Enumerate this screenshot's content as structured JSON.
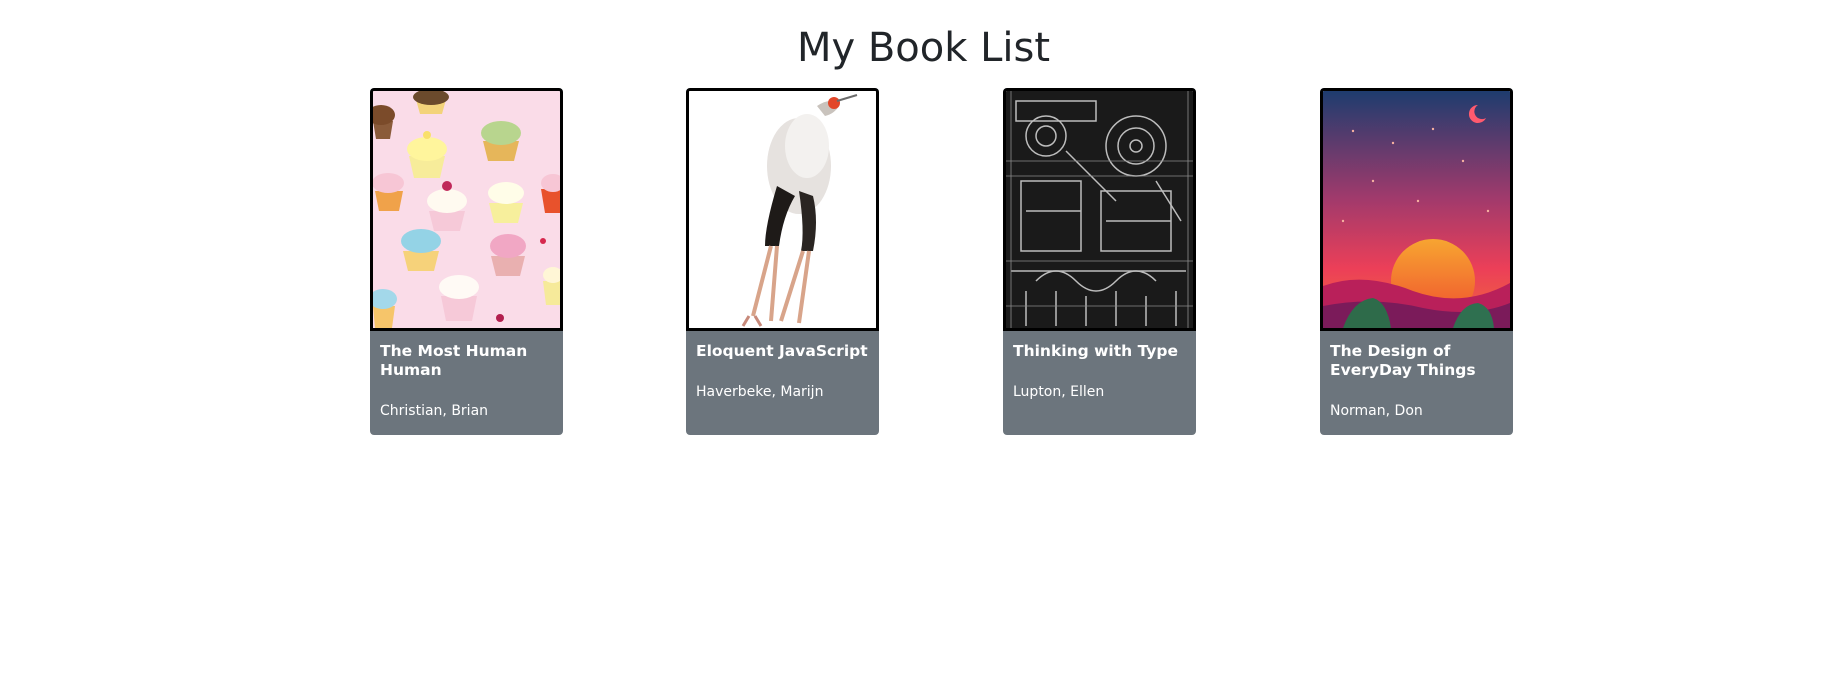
{
  "page": {
    "title": "My Book List"
  },
  "books": [
    {
      "title": "The Most Human Human",
      "author": "Christian, Brian",
      "cover_icon": "cupcakes-cover"
    },
    {
      "title": "Eloquent JavaScript",
      "author": "Haverbeke, Marijn",
      "cover_icon": "secretary-bird-cover"
    },
    {
      "title": "Thinking with Type",
      "author": "Lupton, Ellen",
      "cover_icon": "machinery-engraving-cover"
    },
    {
      "title": "The Design of EveryDay Things",
      "author": "Norman, Don",
      "cover_icon": "sunset-landscape-cover"
    }
  ],
  "colors": {
    "card_background": "#6c757d",
    "card_text": "#ffffff",
    "cover_border": "#000000",
    "title_text": "#212529"
  }
}
